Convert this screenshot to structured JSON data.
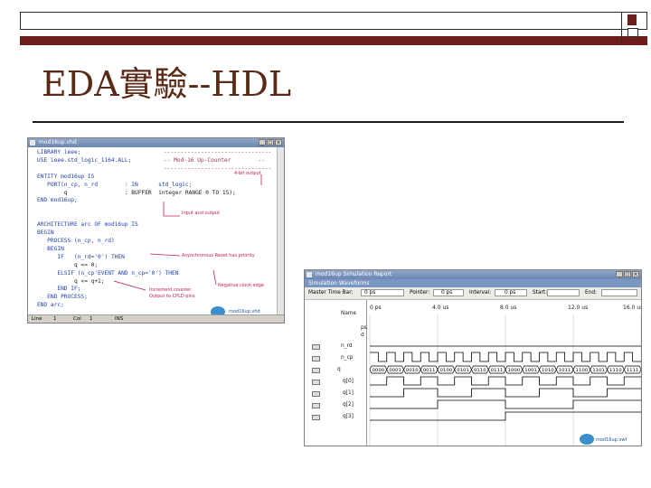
{
  "slide": {
    "title": "EDA實驗--HDL"
  },
  "editor": {
    "window_title": "mod16up.vhd",
    "code_lines": [
      "LIBRARY ieee;",
      "USE ieee.std_logic_1164.ALL;",
      "",
      "ENTITY mod16up IS",
      "   PORT(n_cp, n_rd        : IN      std_logic;",
      "        q                 : BUFFER  integer RANGE 0 TO 15);",
      "END mod16up;",
      "",
      "",
      "ARCHITECTURE arc OF mod16up IS",
      "BEGIN",
      "   PROCESS (n_cp, n_rd)",
      "   BEGIN",
      "      IF   (n_rd='0') THEN",
      "           q <= 0;",
      "      ELSIF (n_cp'EVENT AND n_cp='0') THEN",
      "           q <= q+1;",
      "      END IF;",
      "   END PROCESS;",
      "END arc;"
    ],
    "comment_line1": "--------------------------------",
    "comment_line2": "-- Mod-16 Up-Counter        --",
    "comment_line3": "--------------------------------",
    "annotations": {
      "four_bit_output": "4-bit output",
      "input_output": "Input and output",
      "async_reset": "Asynchronous Reset has priority",
      "negative_clock": "Negative clock edge",
      "increment": "Increment counter",
      "output_pins": "Output to CPLD pins",
      "logo_caption": "mod16up.vhd"
    },
    "status": {
      "line_label": "Line",
      "line_value": "1",
      "col_label": "Col",
      "col_value": "1",
      "mode": "INS"
    }
  },
  "simulation": {
    "window_title": "mod16up Simulation Report",
    "subtitle": "Simulation Waveforms",
    "toolbar": {
      "master_time_bar_label": "Master Time Bar:",
      "master_time_bar_value": "0 ps",
      "pointer_label": "Pointer:",
      "pointer_value": "0 ps",
      "interval_label": "Interval:",
      "interval_value": "0 ps",
      "start_label": "Start:",
      "end_label": "End:"
    },
    "name_header": "Name",
    "time_ticks": [
      "0 ps",
      "4.0 us",
      "8.0 us",
      "12.0 us",
      "16.0 us"
    ],
    "value_col": [
      "ps",
      "d"
    ],
    "signals": [
      "n_rd",
      "n_cp",
      "q",
      "q[0]",
      "q[1]",
      "q[2]",
      "q[3]"
    ],
    "bus_values": [
      "0000",
      "0001",
      "0010",
      "0011",
      "0100",
      "0101",
      "0110",
      "0111",
      "1000",
      "1001",
      "1010",
      "1011",
      "1100",
      "1101",
      "1110",
      "1111"
    ],
    "logo_caption": "mod16up.vwf"
  }
}
